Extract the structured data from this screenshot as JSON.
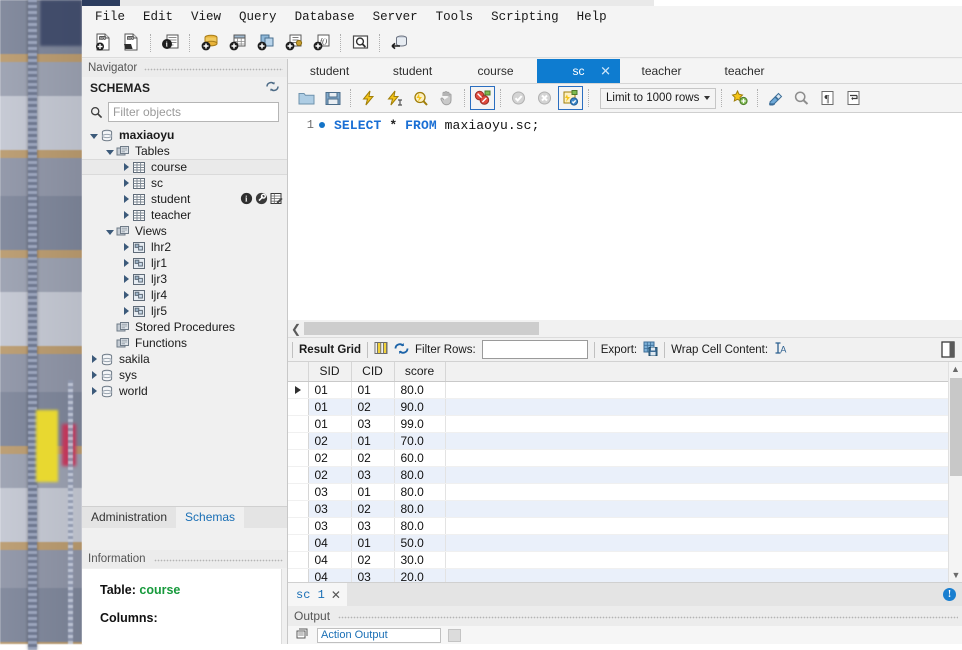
{
  "app": {
    "menu": [
      "File",
      "Edit",
      "View",
      "Query",
      "Database",
      "Server",
      "Tools",
      "Scripting",
      "Help"
    ],
    "main_toolbar_icons": [
      "new-sql-tab-icon",
      "open-sql-script-icon",
      "server-status-icon",
      "new-schema-icon",
      "new-table-icon",
      "new-view-icon",
      "new-stored-procedure-icon",
      "new-function-icon",
      "search-data-icon",
      "reconnect-server-icon"
    ]
  },
  "navigator": {
    "title": "Navigator",
    "section_title": "SCHEMAS",
    "refresh_icon": "refresh-icon",
    "filter": {
      "placeholder": "Filter objects",
      "value": "",
      "icon": "search-icon"
    },
    "tree": [
      {
        "label": "maxiaoyu",
        "icon": "schema-icon",
        "depth": 0,
        "expanded": true,
        "bold": true,
        "selected": false
      },
      {
        "label": "Tables",
        "icon": "folder-icon",
        "depth": 1,
        "expanded": true,
        "bold": false,
        "selected": false
      },
      {
        "label": "course",
        "icon": "table-icon",
        "depth": 2,
        "expanded": false,
        "bold": false,
        "selected": true
      },
      {
        "label": "sc",
        "icon": "table-icon",
        "depth": 2,
        "expanded": false,
        "bold": false,
        "selected": false
      },
      {
        "label": "student",
        "icon": "table-icon",
        "depth": 2,
        "expanded": false,
        "bold": false,
        "selected": false,
        "actions": [
          "info-icon",
          "wrench-icon",
          "table-editor-icon"
        ]
      },
      {
        "label": "teacher",
        "icon": "table-icon",
        "depth": 2,
        "expanded": false,
        "bold": false,
        "selected": false
      },
      {
        "label": "Views",
        "icon": "folder-icon",
        "depth": 1,
        "expanded": true,
        "bold": false,
        "selected": false
      },
      {
        "label": "lhr2",
        "icon": "view-icon",
        "depth": 2,
        "expanded": false,
        "bold": false,
        "selected": false
      },
      {
        "label": "ljr1",
        "icon": "view-icon",
        "depth": 2,
        "expanded": false,
        "bold": false,
        "selected": false
      },
      {
        "label": "ljr3",
        "icon": "view-icon",
        "depth": 2,
        "expanded": false,
        "bold": false,
        "selected": false
      },
      {
        "label": "ljr4",
        "icon": "view-icon",
        "depth": 2,
        "expanded": false,
        "bold": false,
        "selected": false
      },
      {
        "label": "ljr5",
        "icon": "view-icon",
        "depth": 2,
        "expanded": false,
        "bold": false,
        "selected": false
      },
      {
        "label": "Stored Procedures",
        "icon": "folder-icon",
        "depth": 1,
        "expanded": null,
        "bold": false,
        "selected": false
      },
      {
        "label": "Functions",
        "icon": "folder-icon",
        "depth": 1,
        "expanded": null,
        "bold": false,
        "selected": false
      },
      {
        "label": "sakila",
        "icon": "schema-icon",
        "depth": 0,
        "expanded": false,
        "bold": false,
        "selected": false
      },
      {
        "label": "sys",
        "icon": "schema-icon",
        "depth": 0,
        "expanded": false,
        "bold": false,
        "selected": false
      },
      {
        "label": "world",
        "icon": "schema-icon",
        "depth": 0,
        "expanded": false,
        "bold": false,
        "selected": false
      }
    ],
    "bottom_tabs": [
      {
        "label": "Administration",
        "active": false
      },
      {
        "label": "Schemas",
        "active": true
      }
    ],
    "information": {
      "title": "Information",
      "table_label": "Table:",
      "table_name": "course",
      "columns_label": "Columns:"
    }
  },
  "editor": {
    "tabs": [
      {
        "label": "student",
        "active": false,
        "closable": false
      },
      {
        "label": "student",
        "active": false,
        "closable": false
      },
      {
        "label": "course",
        "active": false,
        "closable": false
      },
      {
        "label": "sc",
        "active": true,
        "closable": true
      },
      {
        "label": "teacher",
        "active": false,
        "closable": false
      },
      {
        "label": "teacher",
        "active": false,
        "closable": false
      }
    ],
    "toolbar_icons": [
      "open-file-icon",
      "save-file-icon",
      "execute-icon",
      "execute-current-statement-icon",
      "explain-icon",
      "stop-icon",
      "toggle-stop-on-error-icon",
      "commit-icon",
      "rollback-icon",
      "toggle-autocommit-icon"
    ],
    "limit_label": "Limit to 1000 rows",
    "right_icons": [
      "beautify-icon",
      "clear-context-icon",
      "find-icon",
      "invisible-chars-icon",
      "wrap-lines-icon"
    ],
    "line_number": "1",
    "sql": {
      "keyword1": "SELECT",
      "star": "*",
      "keyword2": "FROM",
      "identifier": "maxiaoyu.sc;"
    }
  },
  "results": {
    "toolbar": {
      "result_grid_label": "Result Grid",
      "form_editor_icon": "form-editor-icon",
      "refresh_icon": "refresh-grid-icon",
      "filter_rows_label": "Filter Rows:",
      "filter_rows_value": "",
      "export_label": "Export:",
      "export_icon": "export-icon",
      "wrap_cell_label": "Wrap Cell Content:",
      "wrap_cell_icon": "wrap-cell-icon",
      "panel_toggle_icon": "toggle-sidebar-icon"
    },
    "columns": [
      "SID",
      "CID",
      "score"
    ],
    "rows": [
      {
        "SID": "01",
        "CID": "01",
        "score": "80.0",
        "current": true
      },
      {
        "SID": "01",
        "CID": "02",
        "score": "90.0",
        "current": false
      },
      {
        "SID": "01",
        "CID": "03",
        "score": "99.0",
        "current": false
      },
      {
        "SID": "02",
        "CID": "01",
        "score": "70.0",
        "current": false
      },
      {
        "SID": "02",
        "CID": "02",
        "score": "60.0",
        "current": false
      },
      {
        "SID": "02",
        "CID": "03",
        "score": "80.0",
        "current": false
      },
      {
        "SID": "03",
        "CID": "01",
        "score": "80.0",
        "current": false
      },
      {
        "SID": "03",
        "CID": "02",
        "score": "80.0",
        "current": false
      },
      {
        "SID": "03",
        "CID": "03",
        "score": "80.0",
        "current": false
      },
      {
        "SID": "04",
        "CID": "01",
        "score": "50.0",
        "current": false
      },
      {
        "SID": "04",
        "CID": "02",
        "score": "30.0",
        "current": false
      },
      {
        "SID": "04",
        "CID": "03",
        "score": "20.0",
        "current": false
      }
    ],
    "result_tab": {
      "label": "sc 1",
      "close_icon": "close-icon"
    },
    "status_icon": "info-badge-icon"
  },
  "output": {
    "title": "Output",
    "selector_value": "Action Output"
  },
  "colors": {
    "accent": "#0e7cd0",
    "sql_keyword": "#1a6fd4",
    "link": "#1a6fb5",
    "alt_row": "#eaf0fa",
    "table_green": "#179a3c"
  }
}
